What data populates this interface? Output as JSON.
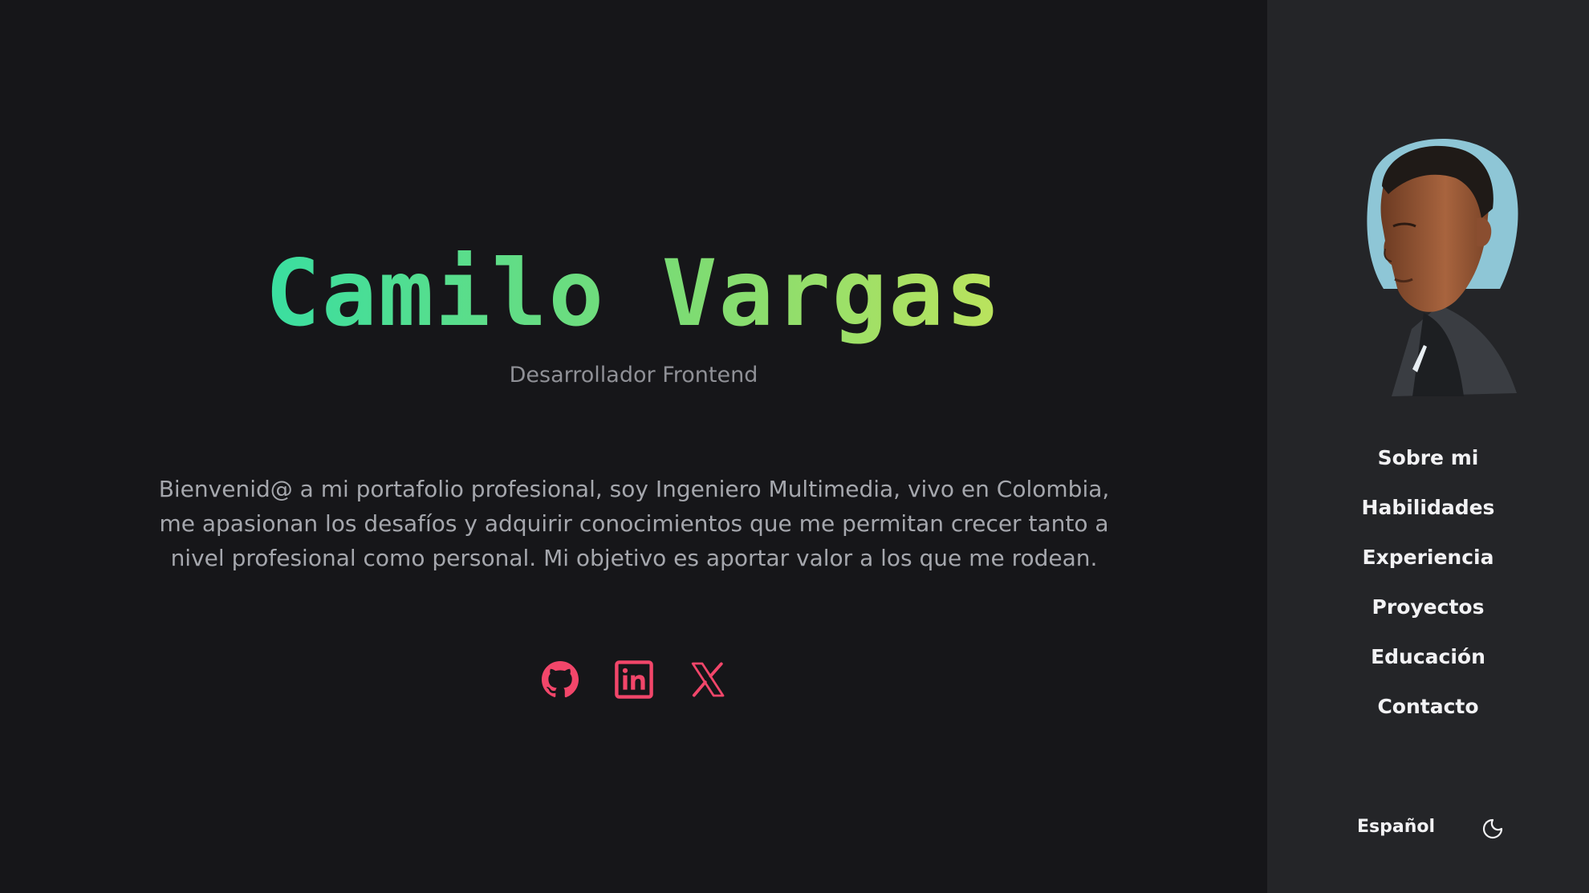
{
  "hero": {
    "name": "Camilo Vargas",
    "role": "Desarrollador Frontend",
    "intro": "Bienvenid@ a mi portafolio profesional, soy Ingeniero Multimedia, vivo en Colombia, me apasionan los desafíos y adquirir conocimientos que me permitan crecer tanto a nivel profesional como personal. Mi objetivo es aportar valor a los que me rodean."
  },
  "socials": [
    {
      "icon": "github-icon"
    },
    {
      "icon": "linkedin-icon"
    },
    {
      "icon": "x-twitter-icon"
    }
  ],
  "sidebar": {
    "avatar": "avatar-illustration",
    "nav": [
      {
        "label": "Sobre mi"
      },
      {
        "label": "Habilidades"
      },
      {
        "label": "Experiencia"
      },
      {
        "label": "Proyectos"
      },
      {
        "label": "Educación"
      },
      {
        "label": "Contacto"
      }
    ],
    "language": "Español",
    "theme_icon": "moon-icon"
  },
  "colors": {
    "background": "#161619",
    "sidebar": "#242528",
    "accent_social": "#f2466a",
    "gradient_start": "#0fe0bd",
    "gradient_end": "#f0ea4a"
  }
}
